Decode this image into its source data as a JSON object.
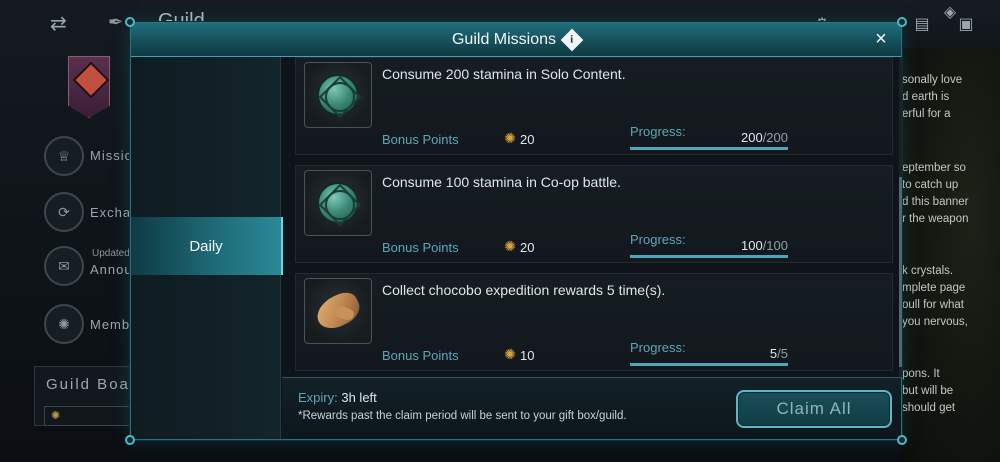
{
  "background": {
    "title": "Guild",
    "side_menu": [
      {
        "label": "Missions",
        "icon": "trophy-icon"
      },
      {
        "label": "Exchange",
        "icon": "exchange-icon"
      },
      {
        "label": "Announcements",
        "update_label": "Updated",
        "icon": "mail-icon"
      },
      {
        "label": "Members",
        "icon": "members-icon"
      }
    ],
    "board_title": "Guild Board",
    "right_text": [
      "sonally love",
      "d earth is",
      "erful for a",
      "",
      "eptember so",
      "to catch up",
      "d this banner",
      "r the weapon",
      "",
      "k crystals.",
      "mplete page",
      "oull for what",
      "you nervous,",
      "",
      "pons. It",
      "but will be",
      "should get"
    ]
  },
  "modal": {
    "title": "Guild Missions",
    "close_label": "×",
    "tabs": [
      {
        "label": "Daily",
        "active": true
      }
    ],
    "missions": [
      {
        "description": "Consume 200 stamina in Solo Content.",
        "icon": "stamina-gem-icon",
        "bonus_label": "Bonus Points",
        "bonus_value": "20",
        "progress_label": "Progress:",
        "progress_current": "200",
        "progress_total": "/200",
        "progress_fraction": 1.0
      },
      {
        "description": "Consume 100 stamina in Co-op battle.",
        "icon": "stamina-gem-icon",
        "bonus_label": "Bonus Points",
        "bonus_value": "20",
        "progress_label": "Progress:",
        "progress_current": "100",
        "progress_total": "/100",
        "progress_fraction": 1.0
      },
      {
        "description": "Collect chocobo expedition rewards 5 time(s).",
        "icon": "chocobo-feather-icon",
        "bonus_label": "Bonus Points",
        "bonus_value": "10",
        "progress_label": "Progress:",
        "progress_current": "5",
        "progress_total": "/5",
        "progress_fraction": 1.0
      }
    ],
    "footer": {
      "expiry_label": "Expiry:",
      "expiry_value": "3h left",
      "note": "*Rewards past the claim period will be sent to your gift box/guild.",
      "claim_label": "Claim All"
    }
  },
  "colors": {
    "accent": "#4fa6b8",
    "header": "#1f6f7d",
    "bonus_icon": "#d7a43c"
  }
}
